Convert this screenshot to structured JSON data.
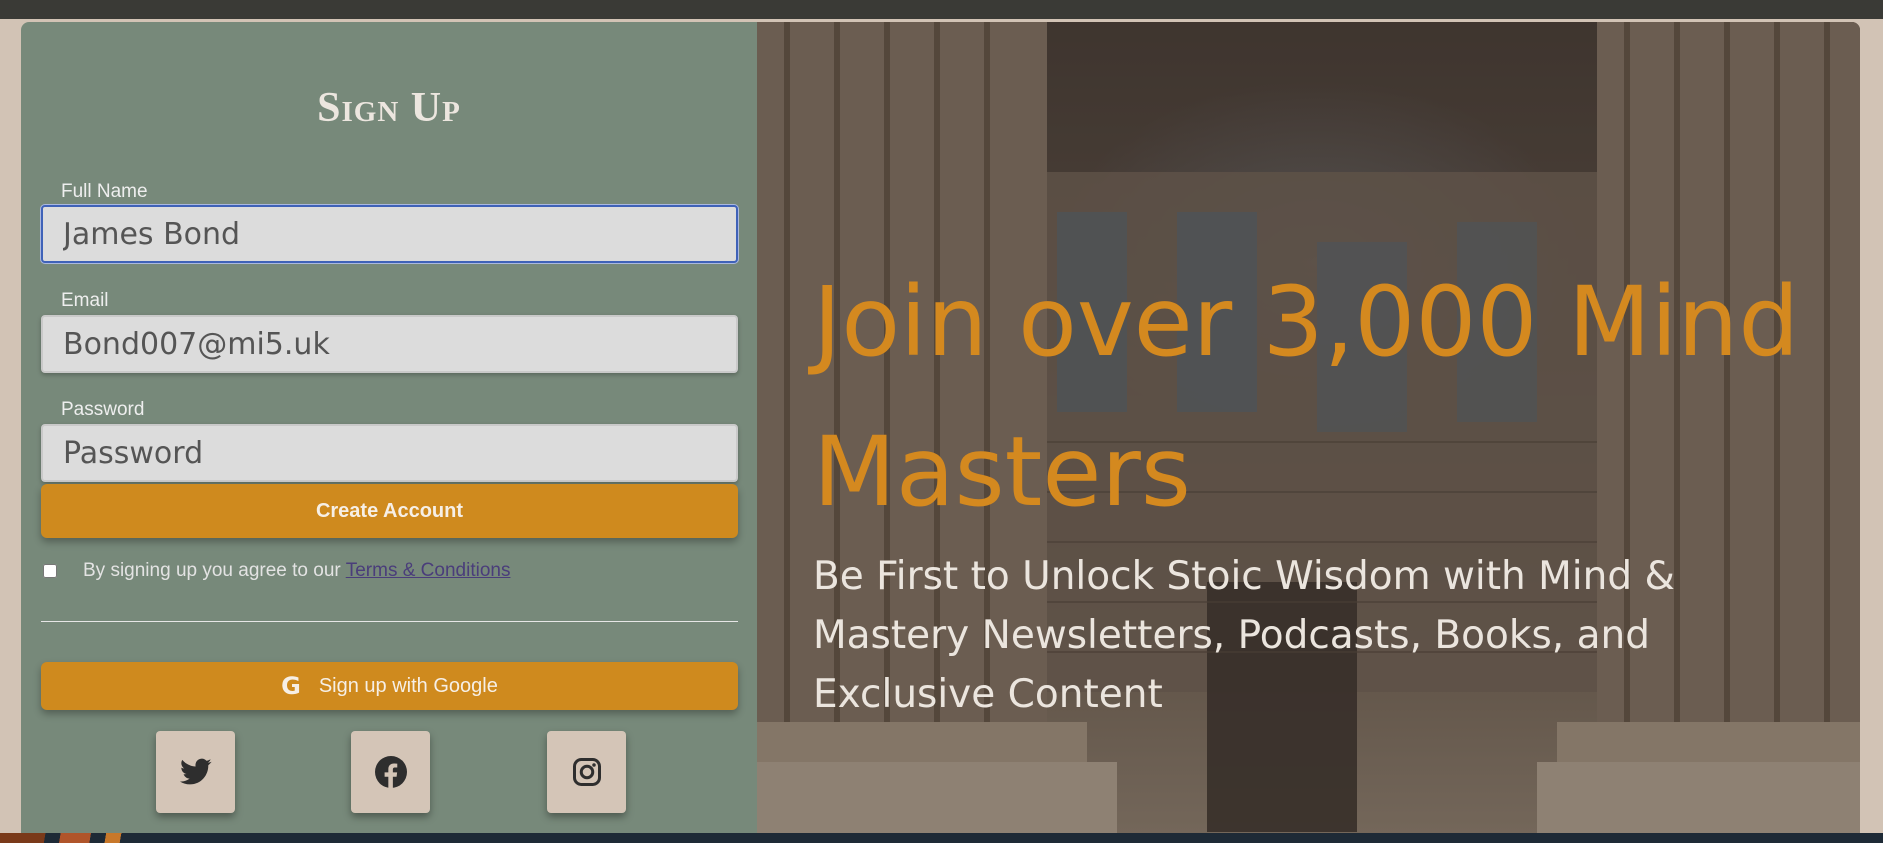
{
  "signup": {
    "title": "Sign Up",
    "full_name": {
      "label": "Full Name",
      "value": "James Bond"
    },
    "email": {
      "label": "Email",
      "value": "Bond007@mi5.uk"
    },
    "password": {
      "label": "Password",
      "placeholder": "Password",
      "value": ""
    },
    "create_button": "Create Account",
    "agree_text": "By signing up you agree to our",
    "terms_link": "Terms & Conditions",
    "terms_checked": false,
    "google_button": "Sign up with Google",
    "google_icon": "google-icon",
    "social": [
      {
        "icon": "twitter-icon"
      },
      {
        "icon": "facebook-icon"
      },
      {
        "icon": "instagram-icon"
      }
    ]
  },
  "hero": {
    "title": "Join over 3,000 Mind Masters",
    "subtitle": "Be First to Unlock Stoic Wisdom with Mind & Mastery Newsletters, Podcasts, Books, and Exclusive Content"
  },
  "colors": {
    "panel": "#77897a",
    "accent": "#cf8a1e",
    "page_bg": "#d2c3b5",
    "hero_title": "#d4891f"
  }
}
